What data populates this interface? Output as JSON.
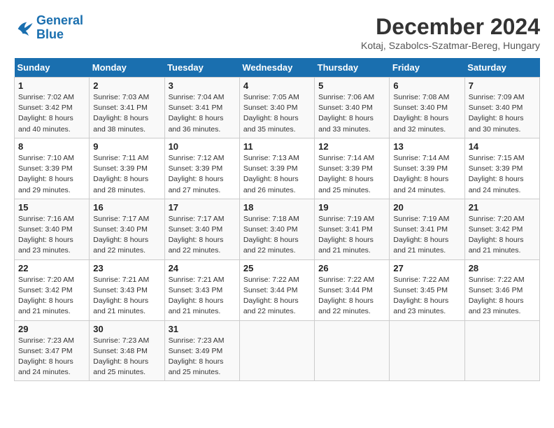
{
  "header": {
    "logo_line1": "General",
    "logo_line2": "Blue",
    "month": "December 2024",
    "location": "Kotaj, Szabolcs-Szatmar-Bereg, Hungary"
  },
  "days_of_week": [
    "Sunday",
    "Monday",
    "Tuesday",
    "Wednesday",
    "Thursday",
    "Friday",
    "Saturday"
  ],
  "weeks": [
    [
      {
        "day": "1",
        "sunrise": "Sunrise: 7:02 AM",
        "sunset": "Sunset: 3:42 PM",
        "daylight": "Daylight: 8 hours and 40 minutes."
      },
      {
        "day": "2",
        "sunrise": "Sunrise: 7:03 AM",
        "sunset": "Sunset: 3:41 PM",
        "daylight": "Daylight: 8 hours and 38 minutes."
      },
      {
        "day": "3",
        "sunrise": "Sunrise: 7:04 AM",
        "sunset": "Sunset: 3:41 PM",
        "daylight": "Daylight: 8 hours and 36 minutes."
      },
      {
        "day": "4",
        "sunrise": "Sunrise: 7:05 AM",
        "sunset": "Sunset: 3:40 PM",
        "daylight": "Daylight: 8 hours and 35 minutes."
      },
      {
        "day": "5",
        "sunrise": "Sunrise: 7:06 AM",
        "sunset": "Sunset: 3:40 PM",
        "daylight": "Daylight: 8 hours and 33 minutes."
      },
      {
        "day": "6",
        "sunrise": "Sunrise: 7:08 AM",
        "sunset": "Sunset: 3:40 PM",
        "daylight": "Daylight: 8 hours and 32 minutes."
      },
      {
        "day": "7",
        "sunrise": "Sunrise: 7:09 AM",
        "sunset": "Sunset: 3:40 PM",
        "daylight": "Daylight: 8 hours and 30 minutes."
      }
    ],
    [
      {
        "day": "8",
        "sunrise": "Sunrise: 7:10 AM",
        "sunset": "Sunset: 3:39 PM",
        "daylight": "Daylight: 8 hours and 29 minutes."
      },
      {
        "day": "9",
        "sunrise": "Sunrise: 7:11 AM",
        "sunset": "Sunset: 3:39 PM",
        "daylight": "Daylight: 8 hours and 28 minutes."
      },
      {
        "day": "10",
        "sunrise": "Sunrise: 7:12 AM",
        "sunset": "Sunset: 3:39 PM",
        "daylight": "Daylight: 8 hours and 27 minutes."
      },
      {
        "day": "11",
        "sunrise": "Sunrise: 7:13 AM",
        "sunset": "Sunset: 3:39 PM",
        "daylight": "Daylight: 8 hours and 26 minutes."
      },
      {
        "day": "12",
        "sunrise": "Sunrise: 7:14 AM",
        "sunset": "Sunset: 3:39 PM",
        "daylight": "Daylight: 8 hours and 25 minutes."
      },
      {
        "day": "13",
        "sunrise": "Sunrise: 7:14 AM",
        "sunset": "Sunset: 3:39 PM",
        "daylight": "Daylight: 8 hours and 24 minutes."
      },
      {
        "day": "14",
        "sunrise": "Sunrise: 7:15 AM",
        "sunset": "Sunset: 3:39 PM",
        "daylight": "Daylight: 8 hours and 24 minutes."
      }
    ],
    [
      {
        "day": "15",
        "sunrise": "Sunrise: 7:16 AM",
        "sunset": "Sunset: 3:40 PM",
        "daylight": "Daylight: 8 hours and 23 minutes."
      },
      {
        "day": "16",
        "sunrise": "Sunrise: 7:17 AM",
        "sunset": "Sunset: 3:40 PM",
        "daylight": "Daylight: 8 hours and 22 minutes."
      },
      {
        "day": "17",
        "sunrise": "Sunrise: 7:17 AM",
        "sunset": "Sunset: 3:40 PM",
        "daylight": "Daylight: 8 hours and 22 minutes."
      },
      {
        "day": "18",
        "sunrise": "Sunrise: 7:18 AM",
        "sunset": "Sunset: 3:40 PM",
        "daylight": "Daylight: 8 hours and 22 minutes."
      },
      {
        "day": "19",
        "sunrise": "Sunrise: 7:19 AM",
        "sunset": "Sunset: 3:41 PM",
        "daylight": "Daylight: 8 hours and 21 minutes."
      },
      {
        "day": "20",
        "sunrise": "Sunrise: 7:19 AM",
        "sunset": "Sunset: 3:41 PM",
        "daylight": "Daylight: 8 hours and 21 minutes."
      },
      {
        "day": "21",
        "sunrise": "Sunrise: 7:20 AM",
        "sunset": "Sunset: 3:42 PM",
        "daylight": "Daylight: 8 hours and 21 minutes."
      }
    ],
    [
      {
        "day": "22",
        "sunrise": "Sunrise: 7:20 AM",
        "sunset": "Sunset: 3:42 PM",
        "daylight": "Daylight: 8 hours and 21 minutes."
      },
      {
        "day": "23",
        "sunrise": "Sunrise: 7:21 AM",
        "sunset": "Sunset: 3:43 PM",
        "daylight": "Daylight: 8 hours and 21 minutes."
      },
      {
        "day": "24",
        "sunrise": "Sunrise: 7:21 AM",
        "sunset": "Sunset: 3:43 PM",
        "daylight": "Daylight: 8 hours and 21 minutes."
      },
      {
        "day": "25",
        "sunrise": "Sunrise: 7:22 AM",
        "sunset": "Sunset: 3:44 PM",
        "daylight": "Daylight: 8 hours and 22 minutes."
      },
      {
        "day": "26",
        "sunrise": "Sunrise: 7:22 AM",
        "sunset": "Sunset: 3:44 PM",
        "daylight": "Daylight: 8 hours and 22 minutes."
      },
      {
        "day": "27",
        "sunrise": "Sunrise: 7:22 AM",
        "sunset": "Sunset: 3:45 PM",
        "daylight": "Daylight: 8 hours and 23 minutes."
      },
      {
        "day": "28",
        "sunrise": "Sunrise: 7:22 AM",
        "sunset": "Sunset: 3:46 PM",
        "daylight": "Daylight: 8 hours and 23 minutes."
      }
    ],
    [
      {
        "day": "29",
        "sunrise": "Sunrise: 7:23 AM",
        "sunset": "Sunset: 3:47 PM",
        "daylight": "Daylight: 8 hours and 24 minutes."
      },
      {
        "day": "30",
        "sunrise": "Sunrise: 7:23 AM",
        "sunset": "Sunset: 3:48 PM",
        "daylight": "Daylight: 8 hours and 25 minutes."
      },
      {
        "day": "31",
        "sunrise": "Sunrise: 7:23 AM",
        "sunset": "Sunset: 3:49 PM",
        "daylight": "Daylight: 8 hours and 25 minutes."
      },
      null,
      null,
      null,
      null
    ]
  ]
}
